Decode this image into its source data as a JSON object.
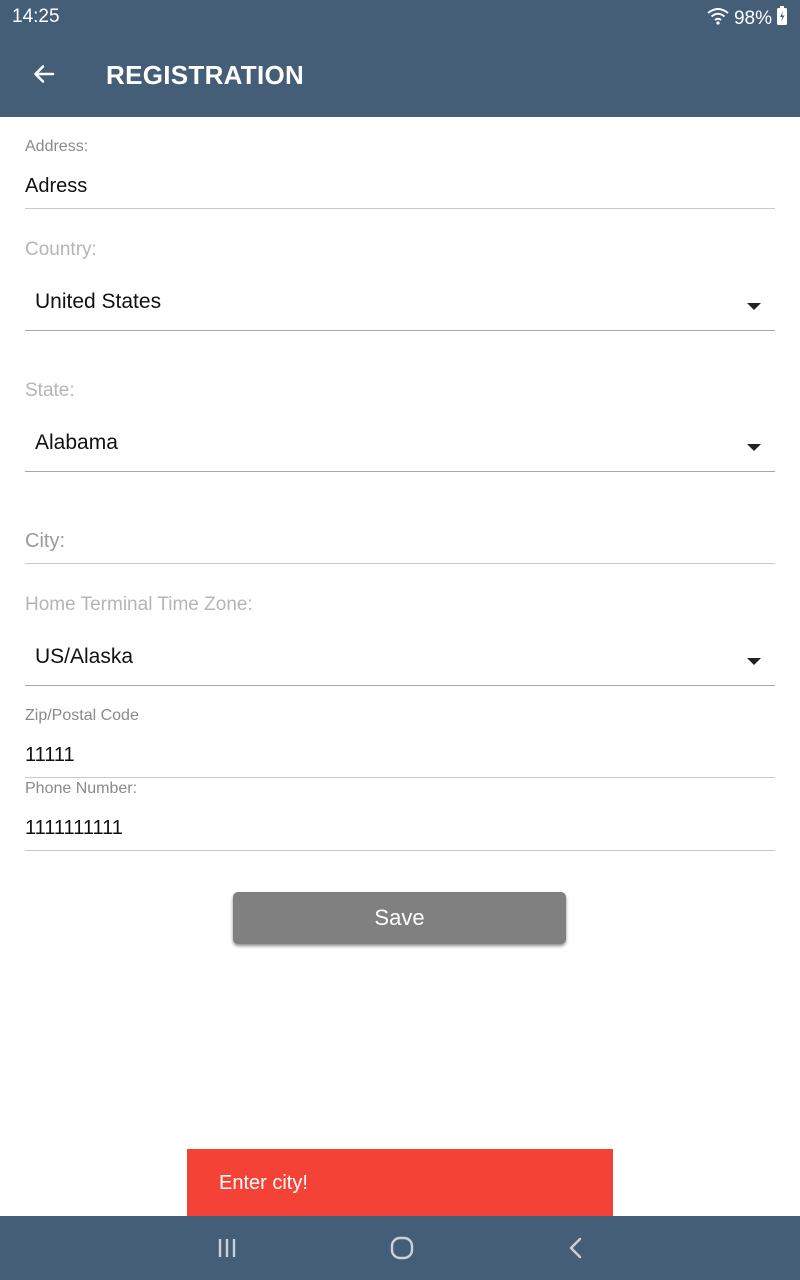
{
  "status_bar": {
    "time": "14:25",
    "battery": "98%"
  },
  "header": {
    "title": "REGISTRATION"
  },
  "form": {
    "address": {
      "label": "Address:",
      "value": "Adress"
    },
    "country": {
      "label": "Country:",
      "value": "United States"
    },
    "state": {
      "label": "State:",
      "value": "Alabama"
    },
    "city": {
      "placeholder": "City:"
    },
    "timezone": {
      "label": "Home Terminal Time Zone:",
      "value": "US/Alaska"
    },
    "zip": {
      "label": "Zip/Postal Code",
      "value": "11111"
    },
    "phone": {
      "label": "Phone Number:",
      "value": "1111111111"
    },
    "save_label": "Save"
  },
  "toast": {
    "message": "Enter city!"
  },
  "colors": {
    "bar": "#455e78",
    "toast": "#f44336",
    "button": "#808080"
  },
  "icons": [
    "back-arrow-icon",
    "wifi-icon",
    "battery-icon",
    "recents-icon",
    "home-icon",
    "nav-back-icon"
  ]
}
